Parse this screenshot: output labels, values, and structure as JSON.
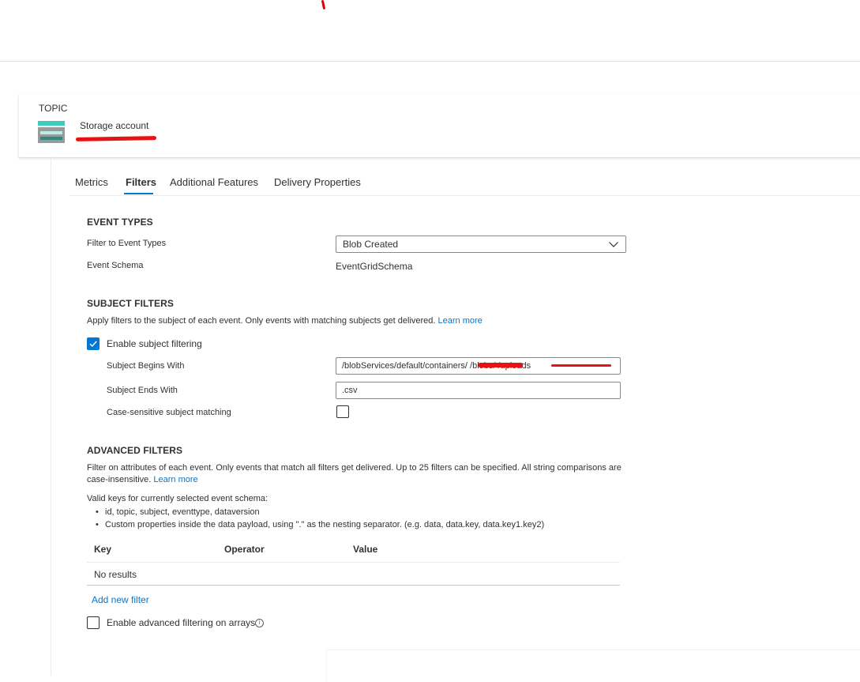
{
  "topic": {
    "label": "TOPIC",
    "type": "Storage account"
  },
  "tabs": [
    {
      "label": "Metrics"
    },
    {
      "label": "Filters"
    },
    {
      "label": "Additional Features"
    },
    {
      "label": "Delivery Properties"
    }
  ],
  "event_types": {
    "title": "EVENT TYPES",
    "filter_label": "Filter to Event Types",
    "filter_value": "Blob Created",
    "schema_label": "Event Schema",
    "schema_value": "EventGridSchema"
  },
  "subject_filters": {
    "title": "SUBJECT FILTERS",
    "description": "Apply filters to the subject of each event. Only events with matching subjects get delivered.",
    "learn_more": "Learn more",
    "enable_label": "Enable subject filtering",
    "enable_checked": true,
    "begins_label": "Subject Begins With",
    "begins_value": "/blobServices/default/containers/                    /blobs/                 /uploads",
    "ends_label": "Subject Ends With",
    "ends_value": ".csv",
    "case_label": "Case-sensitive subject matching",
    "case_checked": false
  },
  "advanced_filters": {
    "title": "ADVANCED FILTERS",
    "description_line1": "Filter on attributes of each event. Only events that match all filters get delivered. Up to 25 filters can be specified. All string comparisons are",
    "description_line2": "case-insensitive.",
    "learn_more": "Learn more",
    "valid_keys_intro": "Valid keys for currently selected event schema:",
    "valid_keys": [
      "id, topic, subject, eventtype, dataversion",
      "Custom properties inside the data payload, using \".\" as the nesting separator. (e.g. data, data.key, data.key1.key2)"
    ],
    "columns": [
      "Key",
      "Operator",
      "Value"
    ],
    "empty_text": "No results",
    "add_filter": "Add new filter",
    "arrays_label": "Enable advanced filtering on arrays",
    "arrays_checked": false
  }
}
